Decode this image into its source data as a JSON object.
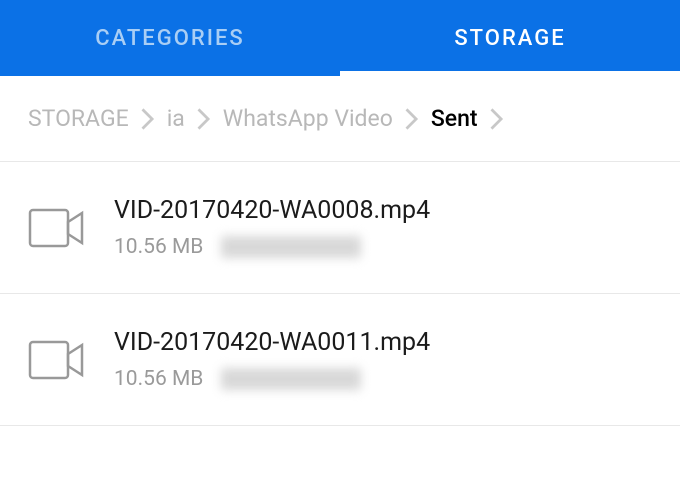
{
  "tabs": [
    {
      "label": "CATEGORIES",
      "active": false
    },
    {
      "label": "STORAGE",
      "active": true
    }
  ],
  "breadcrumb": [
    {
      "label": "STORAGE",
      "current": false
    },
    {
      "label": "ia",
      "current": false
    },
    {
      "label": "WhatsApp Video",
      "current": false
    },
    {
      "label": "Sent",
      "current": true
    }
  ],
  "files": [
    {
      "name": "VID-20170420-WA0008.mp4",
      "size": "10.56 MB"
    },
    {
      "name": "VID-20170420-WA0011.mp4",
      "size": "10.56 MB"
    }
  ]
}
